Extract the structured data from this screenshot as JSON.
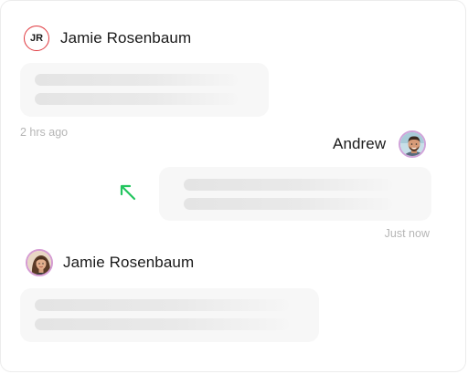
{
  "messages": [
    {
      "sender": "Jamie Rosenbaum",
      "avatar": {
        "type": "initials",
        "initials": "JR",
        "ring_color": "#e0383e"
      },
      "side": "left",
      "content": "placeholder-skeleton",
      "timestamp": "2 hrs ago"
    },
    {
      "sender": "Andrew",
      "avatar": {
        "type": "photo",
        "icon": "man-avatar-photo"
      },
      "side": "right",
      "content": "placeholder-skeleton",
      "timestamp": "Just now"
    },
    {
      "sender": "Jamie Rosenbaum",
      "avatar": {
        "type": "photo",
        "icon": "woman-avatar-photo"
      },
      "side": "left",
      "content": "placeholder-skeleton",
      "timestamp": ""
    }
  ],
  "cursor": {
    "icon": "arrow-cursor-icon",
    "color": "#22c55e"
  },
  "colors": {
    "bubble": "#f7f7f7",
    "skeleton": "#e4e4e4",
    "timestamp": "#b6b6b6",
    "initials_ring": "#e0383e"
  }
}
